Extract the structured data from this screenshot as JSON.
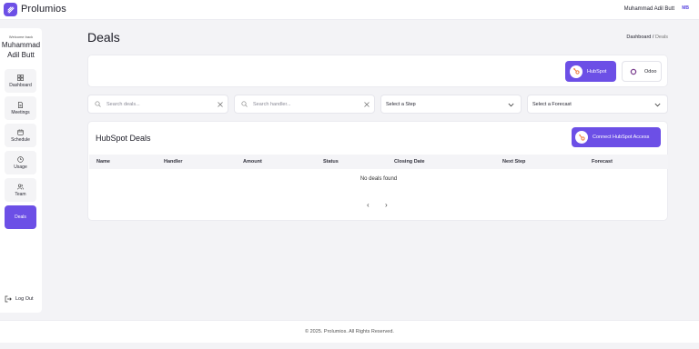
{
  "app": {
    "brand": "Prolumios",
    "user_name": "Muhammad Adil Butt",
    "user_initials": "MB"
  },
  "sidebar": {
    "welcome": "Welcome back",
    "user_first": "Muhammad",
    "user_last": "Adil Butt",
    "items": [
      {
        "label": "Dashboard",
        "icon": "grid-icon"
      },
      {
        "label": "Meetings",
        "icon": "document-icon"
      },
      {
        "label": "Schedule",
        "icon": "calendar-icon"
      },
      {
        "label": "Usage",
        "icon": "clock-icon"
      },
      {
        "label": "Team",
        "icon": "users-icon"
      },
      {
        "label": "Deals",
        "icon": "none",
        "active": true
      }
    ],
    "logout": "Log Out"
  },
  "page": {
    "title": "Deals",
    "breadcrumb_root": "Dashboard",
    "breadcrumb_sep": "/",
    "breadcrumb_current": "Deals"
  },
  "crm": {
    "hubspot": "HubSpot",
    "odoo": "Odoo"
  },
  "filters": {
    "search_deals": "Search deals...",
    "search_handler": "Search handler...",
    "step": "Select a Step",
    "forecast": "Select a Forecast"
  },
  "table": {
    "title": "HubSpot Deals",
    "connect": "Connect HubSpot Access",
    "columns": [
      "Name",
      "Handler",
      "Amount",
      "Status",
      "Closing Date",
      "Next Step",
      "Forecast"
    ],
    "empty": "No deals found",
    "prev": "‹",
    "next": "›"
  },
  "footer": "© 2025. Prolumios. All Rights Reserved.",
  "colors": {
    "accent": "#6c4fe6",
    "background": "#f3f3f6"
  }
}
